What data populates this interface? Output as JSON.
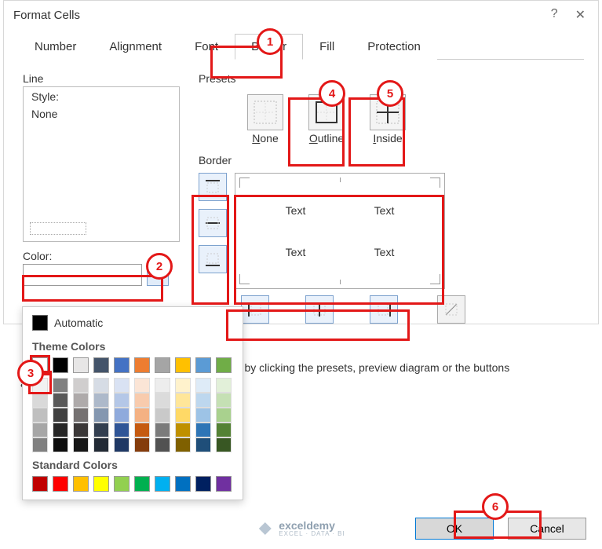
{
  "title": "Format Cells",
  "tabs": [
    "Number",
    "Alignment",
    "Font",
    "Border",
    "Fill",
    "Protection"
  ],
  "active_tab_index": 3,
  "line": {
    "label": "Line",
    "style_label": "Style:",
    "style_value": "None"
  },
  "color_label": "Color:",
  "presets": {
    "label": "Presets",
    "none": "None",
    "outline": "Outline",
    "inside": "Inside"
  },
  "border_label": "Border",
  "preview_text": "Text",
  "note": "plied by clicking the presets, preview diagram or the buttons",
  "color_popup": {
    "automatic": "Automatic",
    "theme_label": "Theme Colors",
    "standard_label": "Standard Colors",
    "theme_colors": [
      "#ffffff",
      "#000000",
      "#e7e6e6",
      "#44546a",
      "#4472c4",
      "#ed7d31",
      "#a5a5a5",
      "#ffc000",
      "#5b9bd5",
      "#70ad47"
    ],
    "theme_tints": [
      [
        "#f2f2f2",
        "#d9d9d9",
        "#bfbfbf",
        "#a6a6a6",
        "#808080"
      ],
      [
        "#808080",
        "#595959",
        "#404040",
        "#262626",
        "#0d0d0d"
      ],
      [
        "#d0cece",
        "#aeaaaa",
        "#757171",
        "#3b3838",
        "#161616"
      ],
      [
        "#d6dce5",
        "#adb9ca",
        "#8497b0",
        "#333f50",
        "#222a35"
      ],
      [
        "#d9e2f3",
        "#b4c7e7",
        "#8faadc",
        "#2f5597",
        "#1f3864"
      ],
      [
        "#fbe5d6",
        "#f8cbad",
        "#f4b183",
        "#c55a11",
        "#843c0c"
      ],
      [
        "#ededed",
        "#dbdbdb",
        "#c9c9c9",
        "#7b7b7b",
        "#525252"
      ],
      [
        "#fff2cc",
        "#ffe699",
        "#ffd966",
        "#bf9000",
        "#7f6000"
      ],
      [
        "#deebf7",
        "#bdd7ee",
        "#9dc3e6",
        "#2e75b6",
        "#1f4e79"
      ],
      [
        "#e2f0d9",
        "#c5e0b4",
        "#a9d18e",
        "#548235",
        "#385723"
      ]
    ],
    "standard_colors": [
      "#c00000",
      "#ff0000",
      "#ffc000",
      "#ffff00",
      "#92d050",
      "#00b050",
      "#00b0f0",
      "#0070c0",
      "#002060",
      "#7030a0"
    ]
  },
  "annotations": [
    "1",
    "2",
    "3",
    "4",
    "5",
    "6"
  ],
  "logo": "exceldemy",
  "logo_sub": "EXCEL · DATA · BI",
  "footer": {
    "ok": "OK",
    "cancel": "Cancel"
  }
}
